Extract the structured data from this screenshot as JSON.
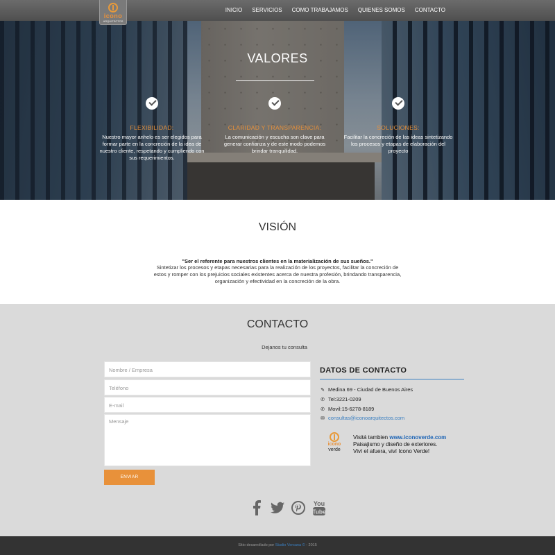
{
  "nav": {
    "logo_name": "icono",
    "logo_sub": "ARQUITECTOS",
    "items": [
      "INICIO",
      "SERVICIOS",
      "COMO TRABAJAMOS",
      "QUIENES SOMOS",
      "CONTACTO"
    ]
  },
  "valores": {
    "title": "VALORES",
    "items": [
      {
        "title": "FLEXIBILIDAD:",
        "text": "Nuestro mayor anhelo es ser elegidos para formar parte en la concreción de la idea de nuestro cliente, respetando y cumpliendo con sus requerimientos."
      },
      {
        "title": "CLARIDAD Y TRANSPARENCIA:",
        "text": "La comunicación y escucha son clave para generar confianza y de este modo podemos brindar tranquilidad."
      },
      {
        "title": "SOLUCIONES:",
        "text": "Facilitar la concreción de las ideas sintetizando los procesos y etapas de elaboración del proyecto"
      }
    ]
  },
  "vision": {
    "title": "VISIÓN",
    "quote": "\"Ser el referente para nuestros clientes en la materialización de sus sueños.\"",
    "body": "Sintetizar los procesos y etapas necesarias para la realización de los proyectos, facilitar la concreción de estos y romper con los prejuicios sociales existentes acerca de nuestra profesión, brindando transparencia, organización y efectividad en la concreción de la obra."
  },
  "contact": {
    "title": "CONTACTO",
    "intro": "Dejanos tu consulta",
    "form": {
      "name_placeholder": "Nombre / Empresa",
      "phone_placeholder": "Teléfono",
      "email_placeholder": "E-mail",
      "message_placeholder": "Mensaje",
      "submit_label": "ENVIAR"
    },
    "details": {
      "title": "DATOS DE CONTACTO",
      "address": "Medina 69 - Ciudad de Buenos Aires",
      "tel": "Tel:3221-0209",
      "movil": "Movil:15-6278-8189",
      "email": "consultas@iconoarquitectos.com"
    },
    "verde": {
      "logo_name": "icono",
      "logo_sub": "verde",
      "line1_prefix": "Visitá tambien",
      "line1_link": "www.iconoverde.com",
      "line2": "Paisajismo y diseño de exteriores.",
      "line3": "Viví el afuera, viví Icono Verde!"
    }
  },
  "social": [
    "facebook-icon",
    "twitter-icon",
    "pinterest-icon",
    "youtube-icon"
  ],
  "footer": {
    "prefix": "Sitio desarrollado por",
    "link": "Studio Versana ©",
    "suffix": "- 2015"
  },
  "colors": {
    "accent": "#e8913a",
    "link": "#3a7fc1",
    "footer_bg": "#333333",
    "contact_bg": "#dadada"
  }
}
